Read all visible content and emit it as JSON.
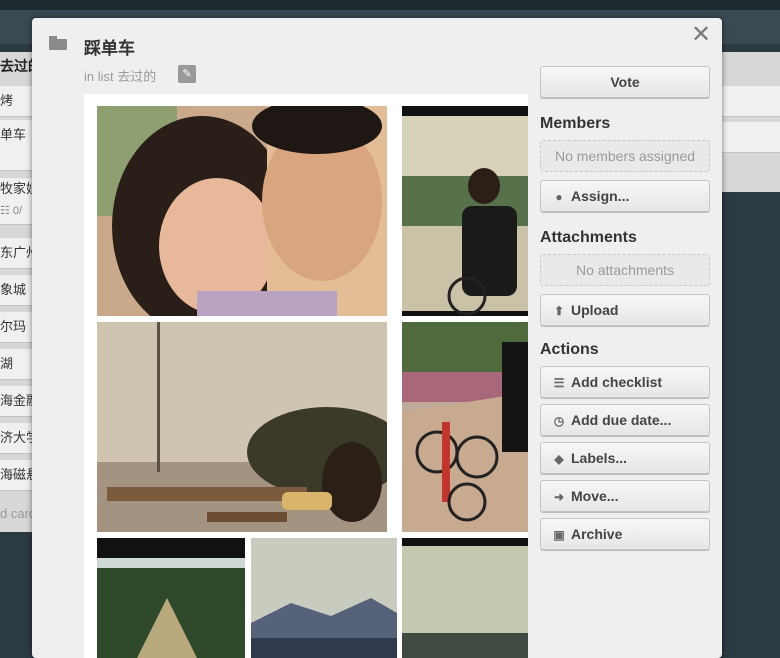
{
  "background": {
    "left_list": {
      "title": "去过的",
      "cards": [
        "烤",
        "单车",
        "",
        "牧家姐",
        "东广州",
        "象城",
        "尔玛",
        "湖",
        "海金融",
        "济大学",
        "海磁悬"
      ],
      "checklist_badge": "☷ 0/",
      "add_card": "d card"
    }
  },
  "modal": {
    "title": "踩单车",
    "in_list_prefix": "in list",
    "list_name": "去过的",
    "close_glyph": "✕",
    "edit_glyph": "✎"
  },
  "sidebar": {
    "vote_label": "Vote",
    "members": {
      "title": "Members",
      "empty": "No members assigned",
      "assign_label": "Assign..."
    },
    "attachments": {
      "title": "Attachments",
      "empty": "No attachments",
      "upload_label": "Upload"
    },
    "actions": {
      "title": "Actions",
      "items": [
        {
          "label": "Add checklist",
          "icon": "checklist-icon"
        },
        {
          "label": "Add due date...",
          "icon": "clock-icon"
        },
        {
          "label": "Labels...",
          "icon": "tag-icon"
        },
        {
          "label": "Move...",
          "icon": "arrow-right-icon"
        },
        {
          "label": "Archive",
          "icon": "archive-icon"
        }
      ]
    }
  },
  "colors": {
    "board_bg": "#2c3a42",
    "modal_bg": "#efefef",
    "button_text": "#444444"
  }
}
